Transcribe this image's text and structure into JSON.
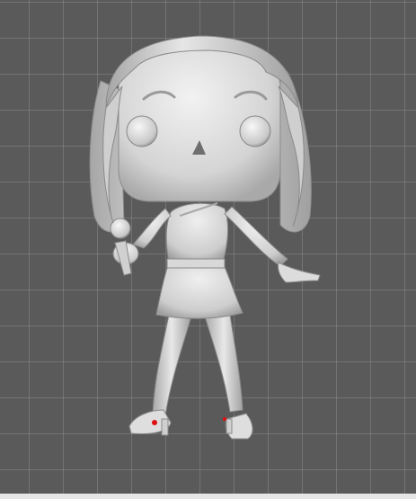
{
  "scene": {
    "background_color": "#5a5a5a",
    "grid_color": "#8c8c8c",
    "model_color": "#d9d9d9",
    "model_shadow_color": "#a8a8a8",
    "highlight_color": "#f2f2f2",
    "marker_color": "#e01010",
    "model_icon": "figurine-singer-icon",
    "objects": [
      "head",
      "hair",
      "eyes",
      "nose",
      "torso",
      "skirt",
      "arm-left-microphone",
      "arm-right-pointing",
      "legs",
      "high-heel-shoes"
    ]
  }
}
